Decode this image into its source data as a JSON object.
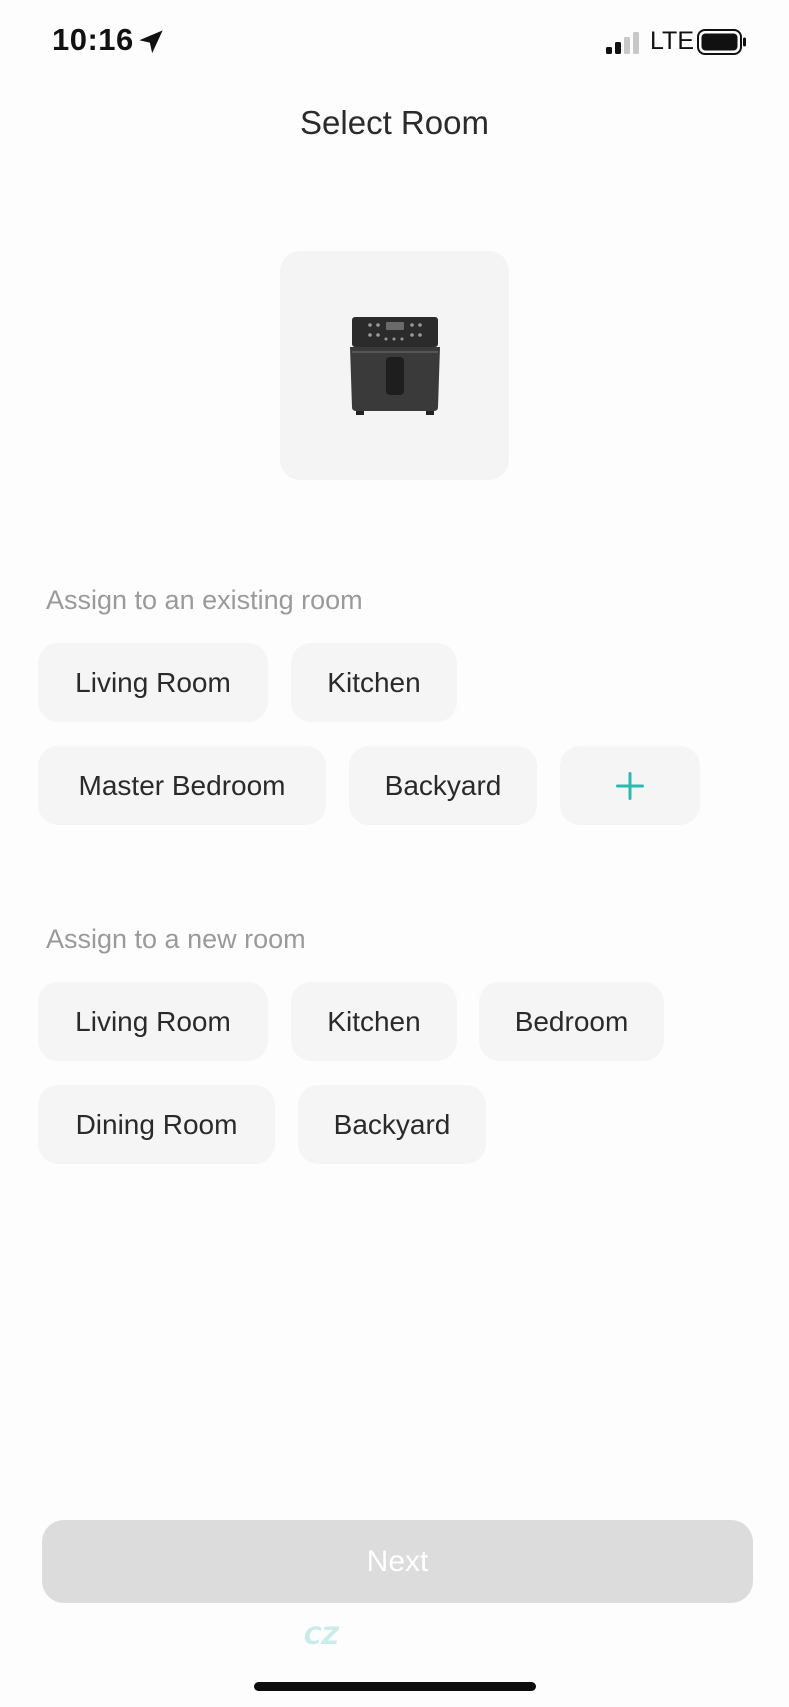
{
  "status_bar": {
    "time": "10:16",
    "carrier": "LTE",
    "icons": [
      "location-arrow-icon",
      "signal-icon",
      "battery-icon"
    ]
  },
  "header": {
    "title": "Select Room"
  },
  "device": {
    "icon": "air-fryer-image"
  },
  "existing_rooms": {
    "label": "Assign to an existing room",
    "items": [
      "Living Room",
      "Kitchen",
      "Master Bedroom",
      "Backyard"
    ],
    "add_icon": "plus-icon"
  },
  "new_rooms": {
    "label": "Assign to a new room",
    "items": [
      "Living Room",
      "Kitchen",
      "Bedroom",
      "Dining Room",
      "Backyard"
    ]
  },
  "footer": {
    "next_label": "Next",
    "watermark": "CZ"
  },
  "colors": {
    "accent": "#2bbab0",
    "chip_bg": "#f5f5f5",
    "button_disabled": "#dcdcdc",
    "label_gray": "#9a9a9a"
  }
}
